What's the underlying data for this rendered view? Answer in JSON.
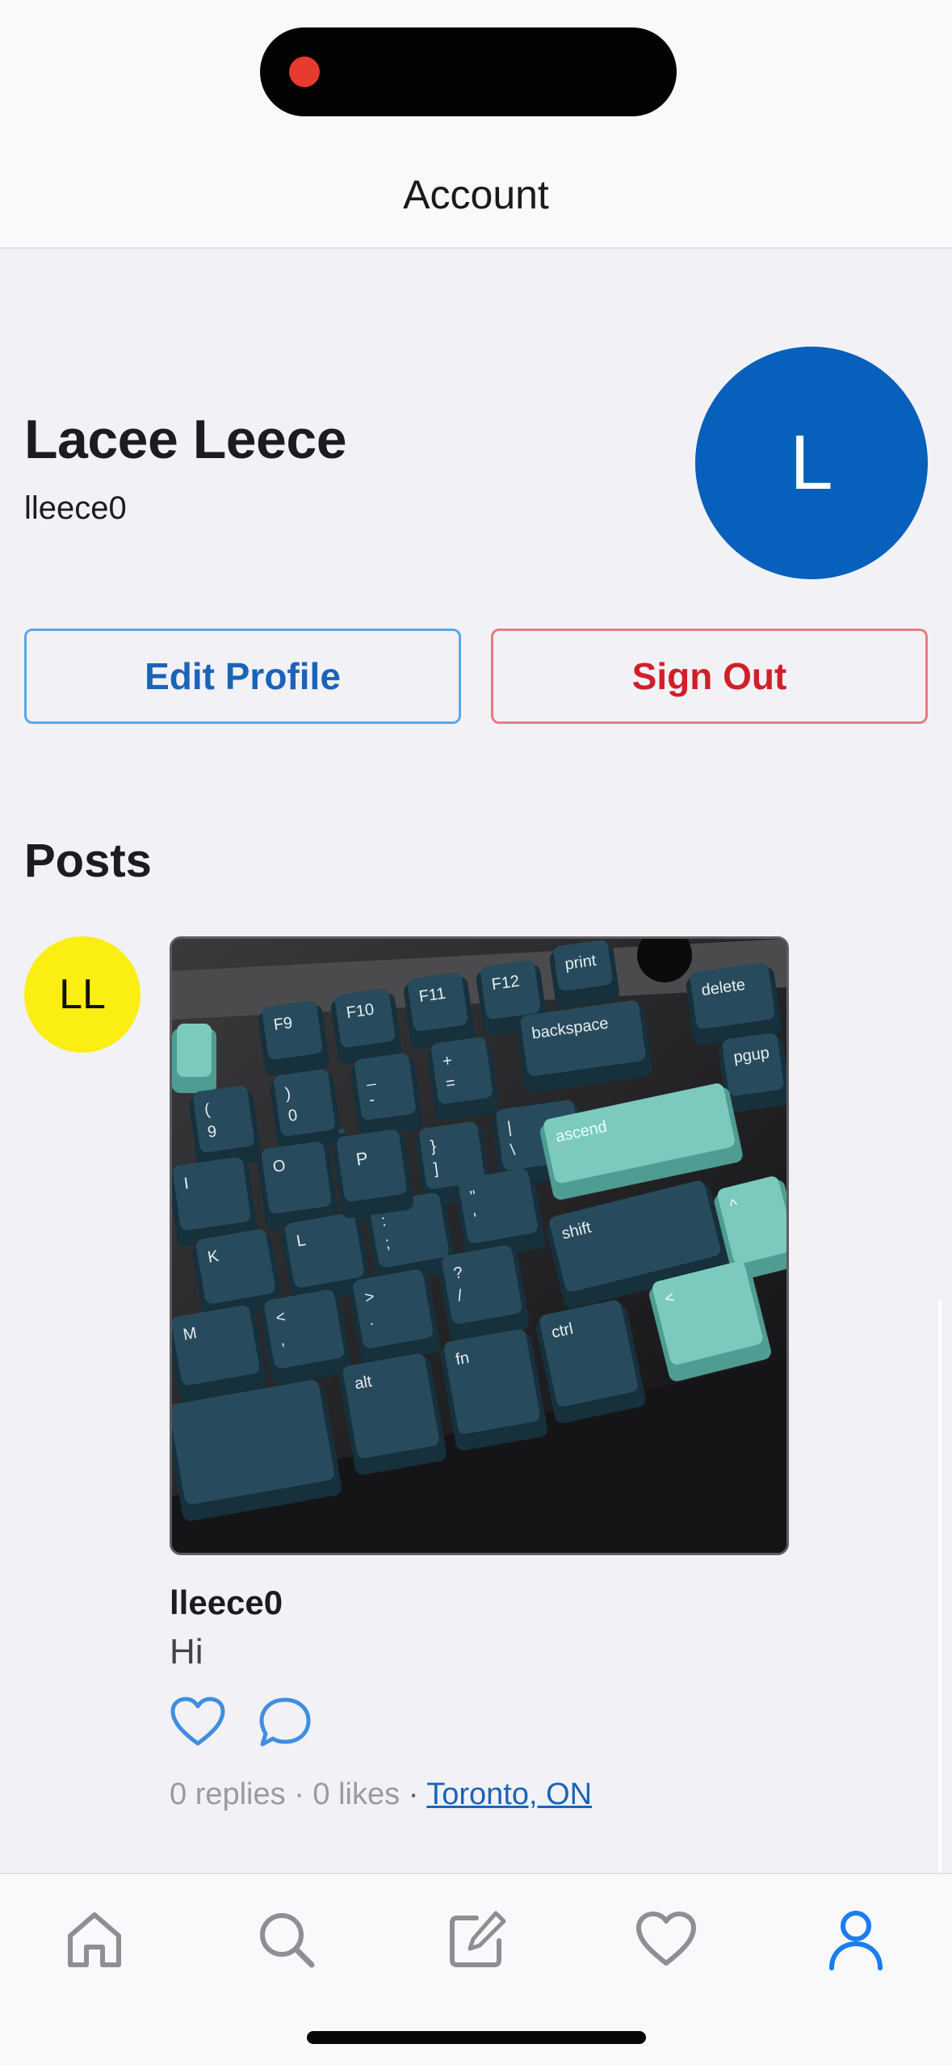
{
  "header": {
    "title": "Account"
  },
  "profile": {
    "name": "Lacee Leece",
    "handle": "lleece0",
    "avatar_initial": "L",
    "avatar_color": "#0760bb"
  },
  "actions": {
    "edit_label": "Edit Profile",
    "signout_label": "Sign Out"
  },
  "posts_section": {
    "title": "Posts"
  },
  "post": {
    "avatar_initials": "LL",
    "avatar_color": "#fbee13",
    "username": "lleece0",
    "text": "Hi",
    "image_keys": {
      "f9": "F9",
      "f10": "F10",
      "f11": "F11",
      "f12": "F12",
      "print": "print",
      "delete": "delete",
      "pgup": "pgup",
      "backspace": "backspace",
      "paren_open": "(",
      "nine": "9",
      "paren_close": ")",
      "zero": "0",
      "minus": "-",
      "underscore": "_",
      "plus": "+",
      "equals": "=",
      "brace_open": "{",
      "bracket_open": "[",
      "brace_close": "}",
      "bracket_close": "]",
      "pipe": "|",
      "backslash": "\\",
      "i": "I",
      "o": "O",
      "p": "P",
      "ascend": "ascend",
      "k": "K",
      "l": "L",
      "colon": ":",
      "semicolon": ";",
      "quote": "\"",
      "apostrophe": "'",
      "shift": "shift",
      "caret": "^",
      "m": "M",
      "lt": "<",
      "comma": ",",
      "gt": ">",
      "period": ".",
      "question": "?",
      "slash": "/",
      "chevron_left": "<",
      "alt": "alt",
      "fn": "fn",
      "ctrl": "ctrl"
    },
    "replies": "0 replies",
    "dot1": "·",
    "likes": "0 likes",
    "dot2": "·",
    "location": "Toronto, ON"
  },
  "tabbar": {
    "tabs": [
      {
        "name": "home-icon",
        "active": false
      },
      {
        "name": "search-icon",
        "active": false
      },
      {
        "name": "compose-icon",
        "active": false
      },
      {
        "name": "heart-icon",
        "active": false
      },
      {
        "name": "person-icon",
        "active": true
      }
    ]
  },
  "colors": {
    "accent": "#1a64b8",
    "danger": "#d11f2a",
    "keycap_dark": "#274b5c",
    "keycap_mint": "#7ccabd"
  }
}
